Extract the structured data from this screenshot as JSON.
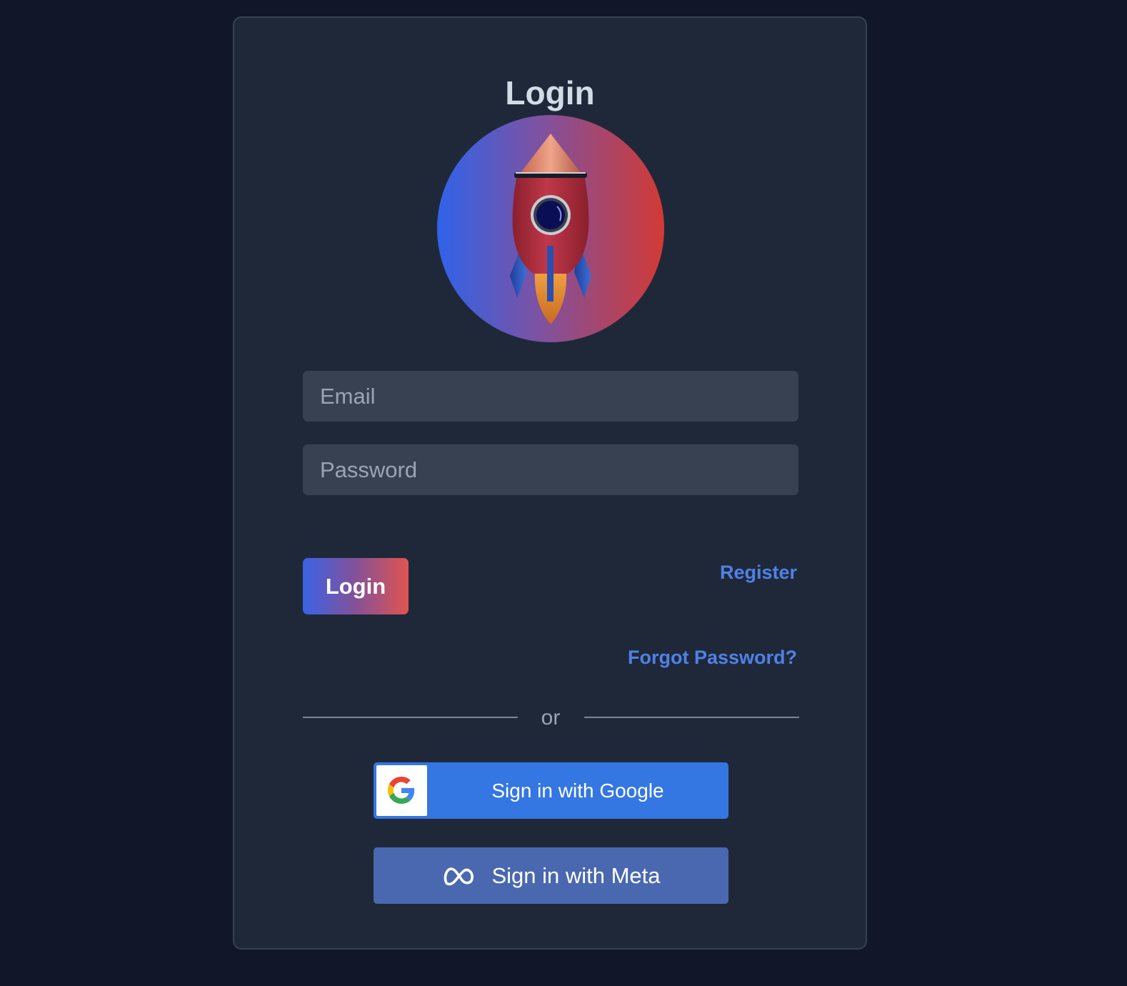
{
  "card": {
    "title": "Login"
  },
  "avatar": {
    "icon": "rocket-icon"
  },
  "form": {
    "email_placeholder": "Email",
    "password_placeholder": "Password",
    "login_label": "Login",
    "register_label": "Register",
    "forgot_label": "Forgot Password?"
  },
  "divider": {
    "label": "or"
  },
  "social": {
    "google_label": "Sign in with Google",
    "google_icon": "google-g-icon",
    "meta_label": "Sign in with Meta",
    "meta_icon": "meta-infinity-icon"
  },
  "colors": {
    "page_bg": "#111729",
    "card_bg": "#1f2839",
    "input_bg": "#374152",
    "link": "#4f81e6",
    "google_blue": "#3476e2",
    "meta_blue": "#4a68b0",
    "gradient_start": "#2f63ea",
    "gradient_end": "#d23a35"
  }
}
